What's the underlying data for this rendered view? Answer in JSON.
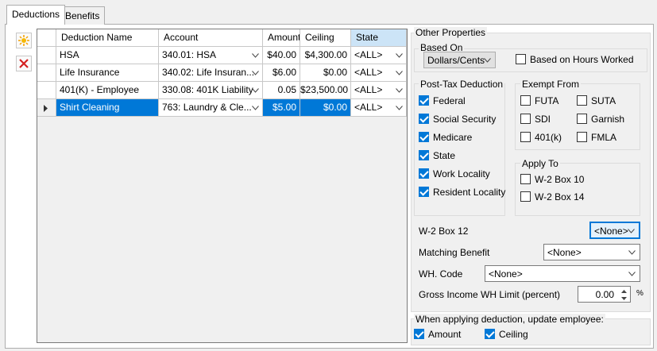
{
  "tabs": [
    {
      "label": "Deductions"
    },
    {
      "label": "Benefits"
    }
  ],
  "toolbar": {
    "add_icon": "sun-add-icon",
    "delete_icon": "red-x-delete-icon"
  },
  "grid": {
    "columns": [
      "Deduction Name",
      "Account",
      "Amount",
      "Ceiling",
      "State"
    ],
    "rows": [
      {
        "name": "HSA",
        "account": "340.01: HSA",
        "amount": "$40.00",
        "ceiling": "$4,300.00",
        "state": "<ALL>"
      },
      {
        "name": "Life Insurance",
        "account": "340.02: Life Insuran...",
        "amount": "$6.00",
        "ceiling": "$0.00",
        "state": "<ALL>"
      },
      {
        "name": "401(K) - Employee",
        "account": "330.08: 401K Liability",
        "amount": "0.05",
        "ceiling": "$23,500.00",
        "state": "<ALL>"
      },
      {
        "name": "Shirt Cleaning",
        "account": "763: Laundry & Cle...",
        "amount": "$5.00",
        "ceiling": "$0.00",
        "state": "<ALL>"
      }
    ],
    "selected_row": 3
  },
  "props": {
    "title": "Other Properties",
    "based_on": {
      "title": "Based On",
      "value": "Dollars/Cents",
      "hours_label": "Based on Hours Worked",
      "hours_checked": false
    },
    "post_tax": {
      "title": "Post-Tax Deduction",
      "items": [
        {
          "label": "Federal",
          "checked": true
        },
        {
          "label": "Social Security",
          "checked": true
        },
        {
          "label": "Medicare",
          "checked": true
        },
        {
          "label": "State",
          "checked": true
        },
        {
          "label": "Work Locality",
          "checked": true
        },
        {
          "label": "Resident Locality",
          "checked": true
        }
      ]
    },
    "exempt": {
      "title": "Exempt From",
      "items": [
        {
          "label": "FUTA",
          "checked": false
        },
        {
          "label": "SUTA",
          "checked": false
        },
        {
          "label": "SDI",
          "checked": false
        },
        {
          "label": "Garnish",
          "checked": false
        },
        {
          "label": "401(k)",
          "checked": false
        },
        {
          "label": "FMLA",
          "checked": false
        }
      ]
    },
    "apply_to": {
      "title": "Apply To",
      "items": [
        {
          "label": "W-2 Box 10",
          "checked": false
        },
        {
          "label": "W-2 Box 14",
          "checked": false
        }
      ]
    },
    "w2box12": {
      "label": "W-2 Box 12",
      "value": "<None>"
    },
    "matching": {
      "label": "Matching Benefit",
      "value": "<None>"
    },
    "whcode": {
      "label": "WH. Code",
      "value": "<None>"
    },
    "gross": {
      "label": "Gross Income WH Limit (percent)",
      "value": "0.00",
      "unit": "%"
    },
    "update": {
      "title": "When applying deduction, update employee:",
      "amount_label": "Amount",
      "amount_checked": true,
      "ceiling_label": "Ceiling",
      "ceiling_checked": true
    }
  }
}
